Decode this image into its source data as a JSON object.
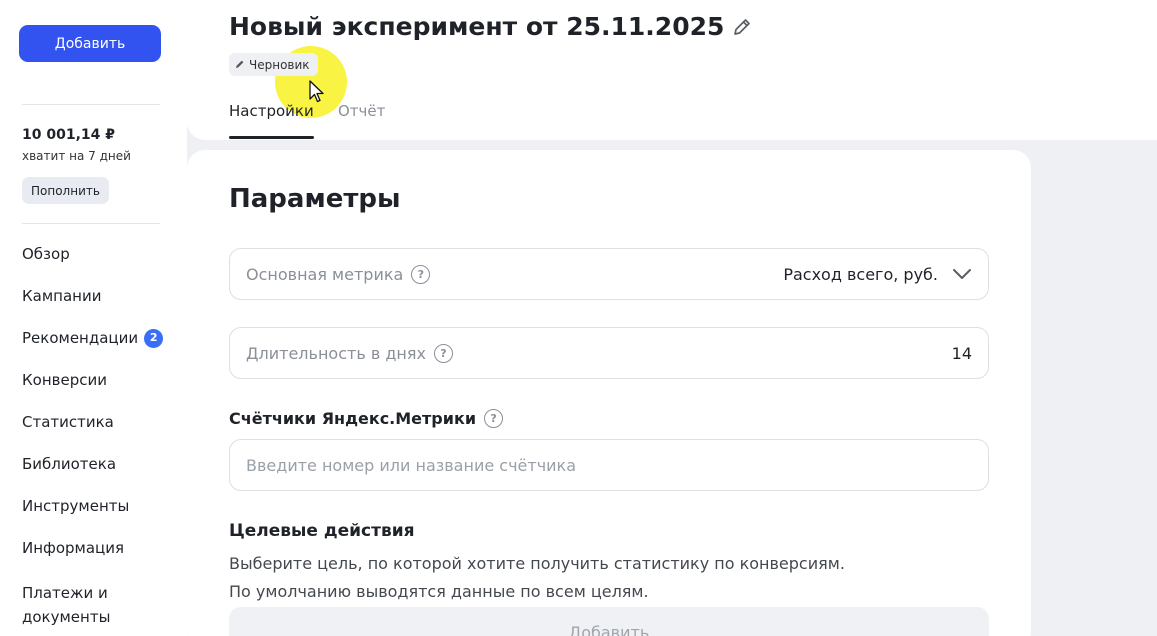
{
  "sidebar": {
    "add_button": "Добавить",
    "balance": {
      "amount": "10 001,14 ₽",
      "days_left": "хватит на 7 дней",
      "topup_button": "Пополнить"
    },
    "nav": [
      {
        "label": "Обзор"
      },
      {
        "label": "Кампании"
      },
      {
        "label": "Рекомендации",
        "badge": "2"
      },
      {
        "label": "Конверсии"
      },
      {
        "label": "Статистика"
      },
      {
        "label": "Библиотека"
      },
      {
        "label": "Инструменты"
      },
      {
        "label": "Информация"
      },
      {
        "label": "Платежи и документы"
      }
    ]
  },
  "header": {
    "title": "Новый эксперимент от 25.11.2025",
    "status_chip": "Черновик",
    "tabs": [
      {
        "label": "Настройки",
        "active": true
      },
      {
        "label": "Отчёт",
        "active": false
      }
    ]
  },
  "params": {
    "section_title": "Параметры",
    "main_metric": {
      "label": "Основная метрика",
      "value": "Расход всего, руб."
    },
    "duration": {
      "label": "Длительность в днях",
      "value": "14"
    },
    "counters": {
      "label": "Счётчики Яндекс.Метрики",
      "placeholder": "Введите номер или название счётчика"
    },
    "goals": {
      "title": "Целевые действия",
      "description_line1": "Выберите цель, по которой хотите получить статистику по конверсиям.",
      "description_line2": "По умолчанию выводятся данные по всем целям.",
      "add_button": "Добавить"
    }
  },
  "colors": {
    "accent": "#3253f0",
    "badge": "#3b6ef6",
    "highlight": "#f8f014",
    "background": "#eef0f4"
  }
}
